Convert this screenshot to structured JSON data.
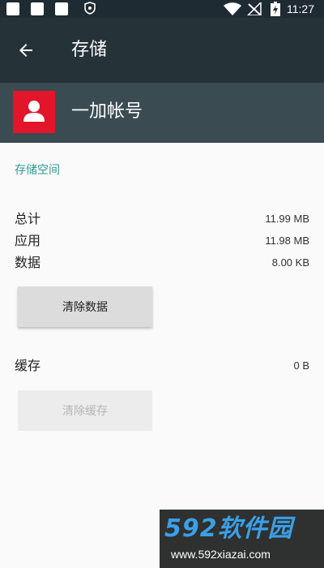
{
  "status_bar": {
    "time": "11:27",
    "icons": [
      "notification-square-icon",
      "shield-icon",
      "wifi-icon",
      "no-signal-icon",
      "battery-charging-icon"
    ]
  },
  "toolbar": {
    "title": "存储",
    "back_icon": "arrow-back-icon"
  },
  "app": {
    "name": "一加帐号",
    "icon": "account-person-icon",
    "icon_color": "#e2152a"
  },
  "storage": {
    "section_title": "存储空间",
    "rows": [
      {
        "label": "总计",
        "value": "11.99 MB"
      },
      {
        "label": "应用",
        "value": "11.98 MB"
      },
      {
        "label": "数据",
        "value": "8.00 KB"
      }
    ],
    "clear_data_label": "清除数据"
  },
  "cache": {
    "label": "缓存",
    "value": "0 B",
    "clear_cache_label": "清除缓存"
  },
  "watermark": {
    "brand": "592软件园",
    "url": "www.592xiazai.com"
  },
  "colors": {
    "toolbar": "#253238",
    "accent": "#2b9c8f"
  }
}
